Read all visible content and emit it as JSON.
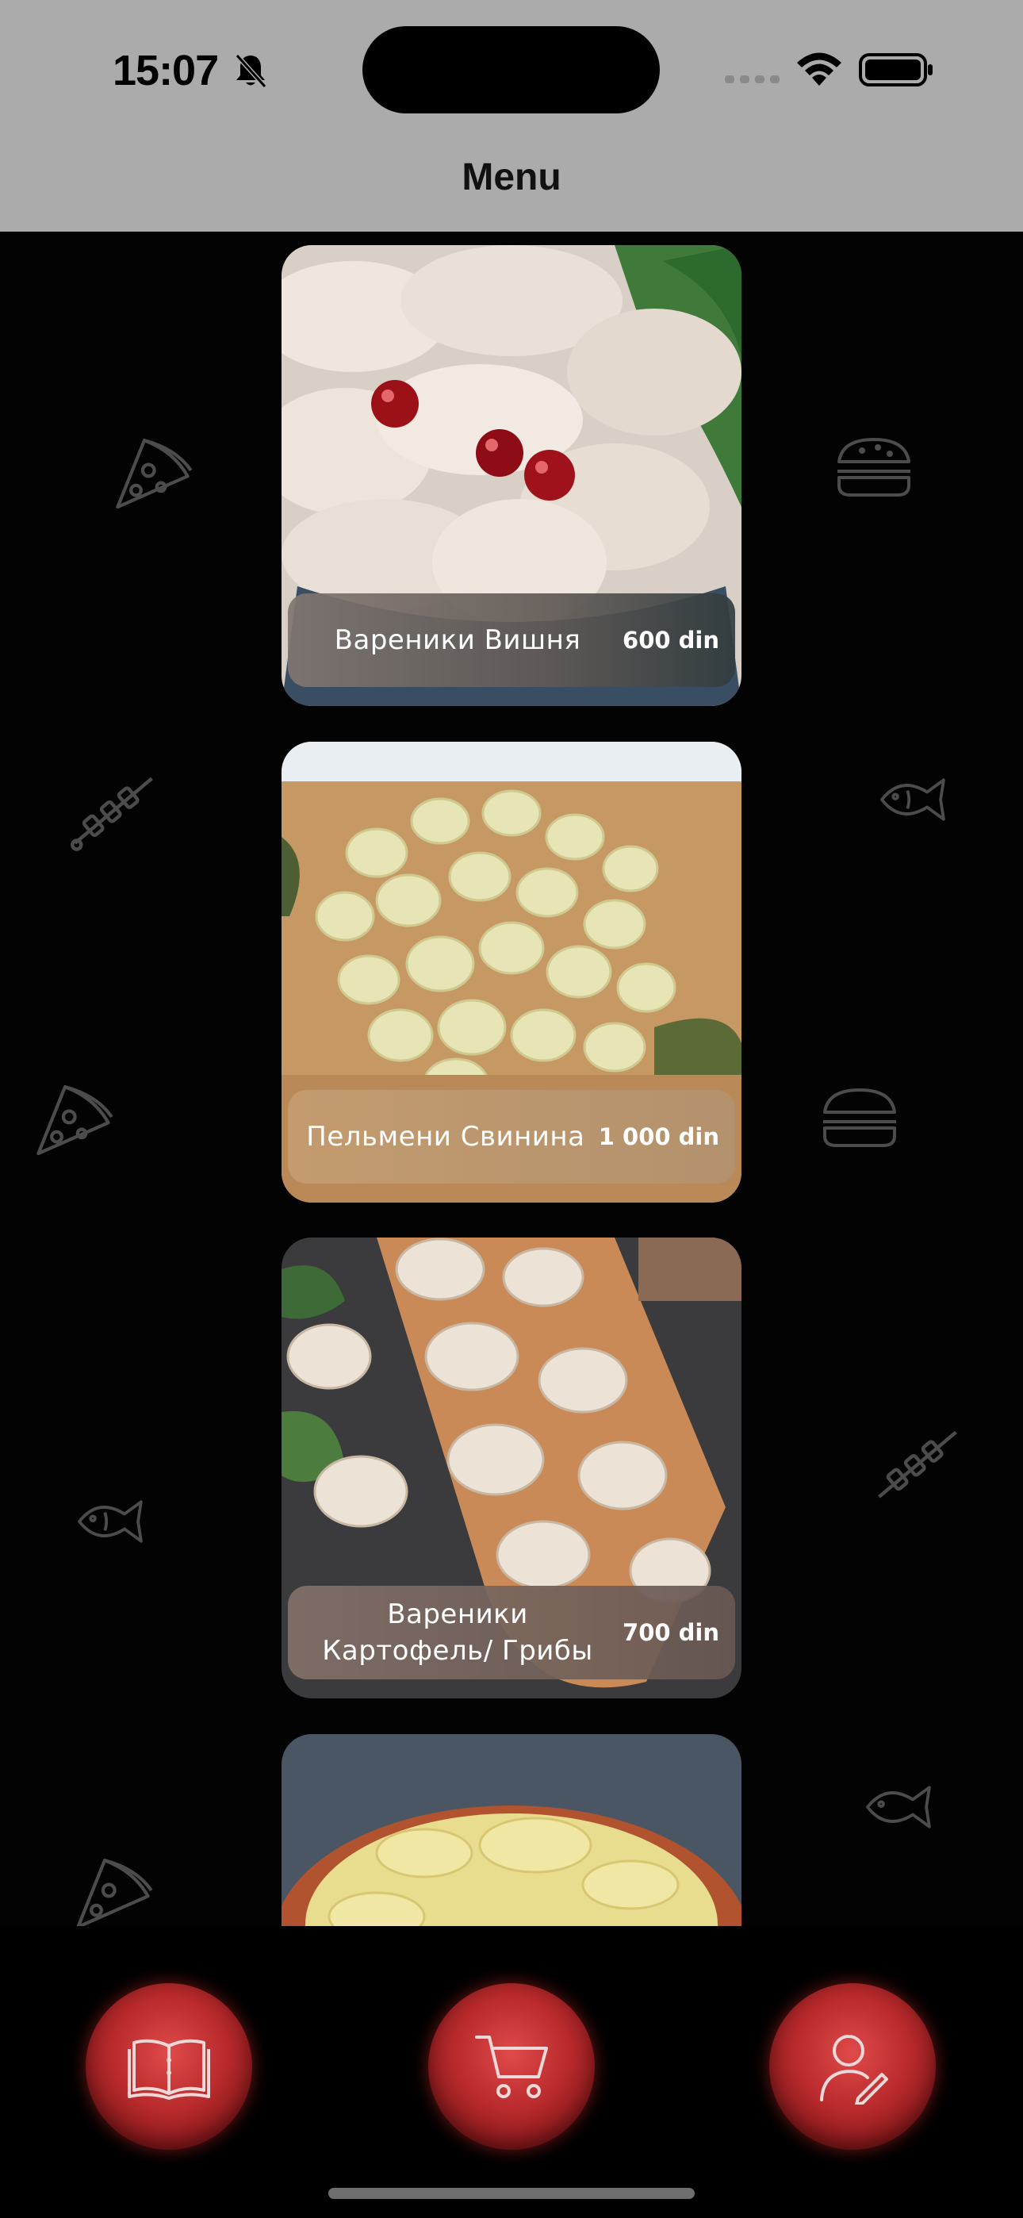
{
  "status_bar": {
    "time": "15:07",
    "icons": [
      "bell-slash-icon",
      "cellular-signal-icon",
      "wifi-icon",
      "battery-icon"
    ]
  },
  "nav": {
    "title": "Menu"
  },
  "menu_items": [
    {
      "name": "Вареники Вишня",
      "price": "600 din",
      "image": "cherry-dumplings"
    },
    {
      "name": "Пельмени Свинина",
      "price": "1 000 din",
      "image": "pork-pelmeni"
    },
    {
      "name": "Вареники Картофель/ Грибы",
      "price": "700 din",
      "image": "potato-mushroom-dumplings"
    },
    {
      "name": "",
      "price": "",
      "image": "dumplings-bowl"
    }
  ],
  "background_icons": [
    "pizza-slice-icon",
    "burger-icon",
    "skewer-icon",
    "fish-icon"
  ],
  "tab_bar": {
    "tabs": [
      {
        "icon": "menu-book-icon"
      },
      {
        "icon": "cart-icon"
      },
      {
        "icon": "profile-edit-icon"
      }
    ]
  },
  "colors": {
    "accent": "#b82a2c",
    "header_bg": "#ababab",
    "page_bg": "#030303"
  }
}
